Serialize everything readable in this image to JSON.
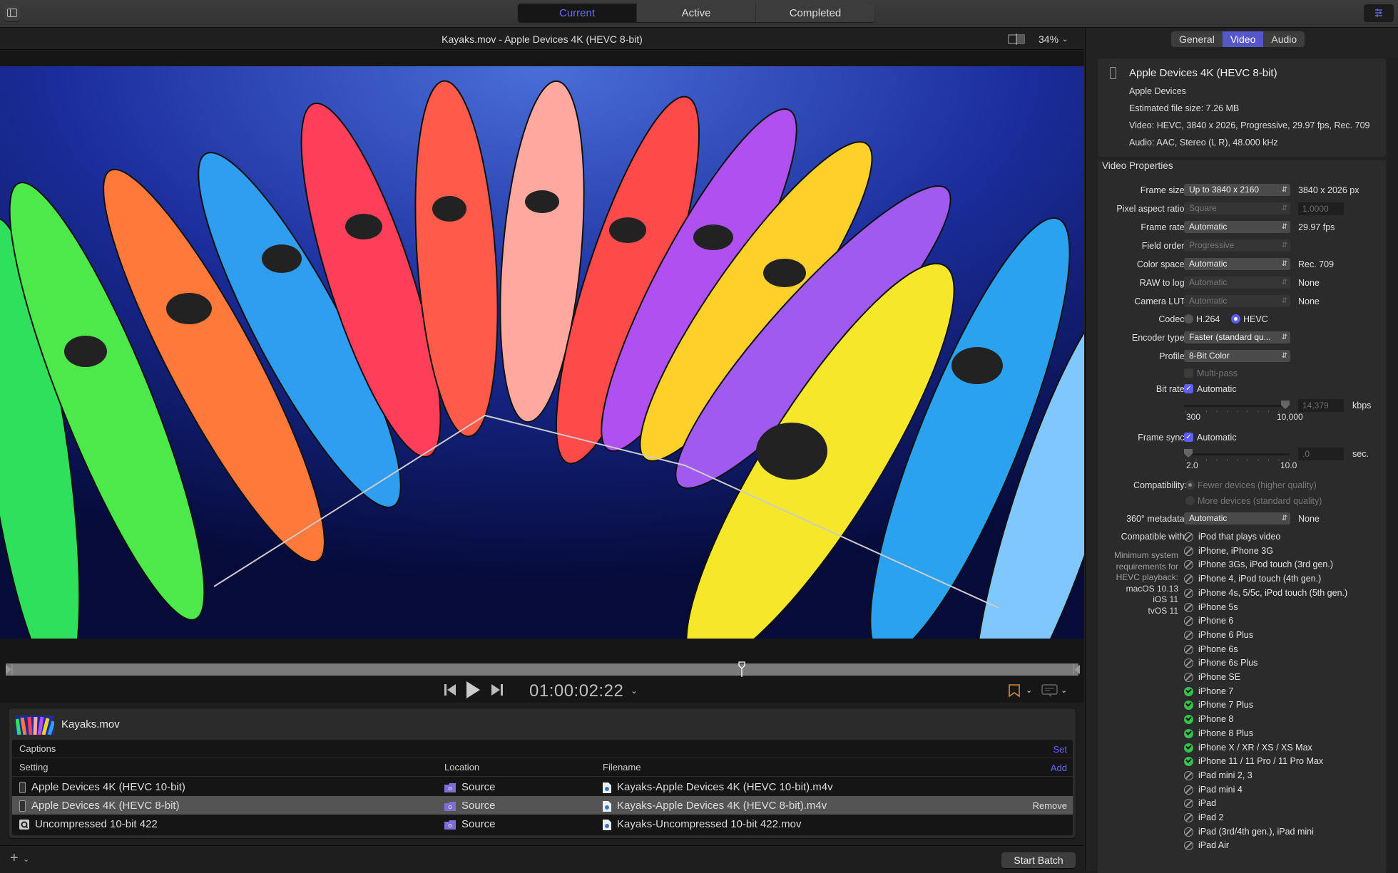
{
  "toolbar": {
    "tabs": [
      {
        "label": "Current",
        "active": true
      },
      {
        "label": "Active",
        "active": false
      },
      {
        "label": "Completed",
        "active": false
      }
    ],
    "sidebar_toggle_icon": "sidebar-icon",
    "inspector_toggle_icon": "sliders-icon"
  },
  "viewer": {
    "title": "Kayaks.mov - Apple Devices 4K (HEVC 8-bit)",
    "zoom": "34%",
    "timecode": "01:00:02:22",
    "playhead_position": 0.686
  },
  "batch": {
    "job_name": "Kayaks.mov",
    "captions_label": "Captions",
    "captions_action": "Set",
    "columns": {
      "setting": "Setting",
      "location": "Location",
      "filename": "Filename",
      "add": "Add"
    },
    "rows": [
      {
        "setting": "Apple Devices 4K (HEVC 10-bit)",
        "icon": "phone-icon",
        "location": "Source",
        "filename": "Kayaks-Apple Devices 4K (HEVC 10-bit).m4v",
        "selected": false,
        "action": ""
      },
      {
        "setting": "Apple Devices 4K (HEVC 8-bit)",
        "icon": "phone-icon",
        "location": "Source",
        "filename": "Kayaks-Apple Devices 4K (HEVC 8-bit).m4v",
        "selected": true,
        "action": "Remove"
      },
      {
        "setting": "Uncompressed 10-bit 422",
        "icon": "quicktime-icon",
        "location": "Source",
        "filename": "Kayaks-Uncompressed 10-bit 422.mov",
        "selected": false,
        "action": ""
      }
    ],
    "start_batch": "Start Batch",
    "add_symbol": "+"
  },
  "inspector": {
    "tabs": [
      {
        "label": "General",
        "active": false
      },
      {
        "label": "Video",
        "active": true
      },
      {
        "label": "Audio",
        "active": false
      }
    ],
    "summary": {
      "title": "Apple Devices 4K (HEVC 8-bit)",
      "category": "Apple Devices",
      "file_size": "Estimated file size: 7.26 MB",
      "video": "Video: HEVC, 3840 x 2026, Progressive, 29.97 fps, Rec. 709",
      "audio": "Audio: AAC, Stereo (L R), 48.000 kHz"
    },
    "section_title": "Video Properties",
    "frame_size": {
      "label": "Frame size:",
      "value": "Up to 3840 x 2160",
      "result": "3840 x 2026 px"
    },
    "pixel_aspect": {
      "label": "Pixel aspect ratio:",
      "value": "Square",
      "result": "1.0000"
    },
    "frame_rate": {
      "label": "Frame rate:",
      "value": "Automatic",
      "result": "29.97 fps"
    },
    "field_order": {
      "label": "Field order:",
      "value": "Progressive"
    },
    "color_space": {
      "label": "Color space:",
      "value": "Automatic",
      "result": "Rec. 709"
    },
    "raw_to_log": {
      "label": "RAW to log:",
      "value": "Automatic",
      "result": "None"
    },
    "camera_lut": {
      "label": "Camera LUT:",
      "value": "Automatic",
      "result": "None"
    },
    "codec": {
      "label": "Codec:",
      "options": [
        "H.264",
        "HEVC"
      ],
      "selected": "HEVC"
    },
    "encoder_type": {
      "label": "Encoder type:",
      "value": "Faster (standard qu..."
    },
    "profile": {
      "label": "Profile:",
      "value": "8-Bit Color"
    },
    "multipass": {
      "label": "Multi-pass",
      "checked": false
    },
    "bit_rate": {
      "label": "Bit rate:",
      "auto_label": "Automatic",
      "auto": true,
      "value": "14,379",
      "unit": "kbps",
      "min": "300",
      "max": "10,000",
      "slider_fraction": 1.0
    },
    "frame_sync": {
      "label": "Frame sync:",
      "auto_label": "Automatic",
      "auto": true,
      "value": ".0",
      "unit": "sec.",
      "min": "2.0",
      "max": "10.0",
      "slider_fraction": 0.0
    },
    "compatibility": {
      "label": "Compatibility:",
      "options": [
        "Fewer devices (higher quality)",
        "More devices (standard quality)"
      ],
      "selected": "Fewer devices (higher quality)"
    },
    "metadata_360": {
      "label": "360° metadata:",
      "value": "Automatic",
      "result": "None"
    },
    "compatible_with_label": "Compatible with:",
    "min_requirements": [
      "Minimum system",
      "requirements for",
      "HEVC playback:"
    ],
    "min_os": [
      "macOS 10.13",
      "iOS 11",
      "tvOS 11"
    ],
    "devices": [
      {
        "name": "iPod that plays video",
        "compatible": false
      },
      {
        "name": "iPhone, iPhone 3G",
        "compatible": false
      },
      {
        "name": "iPhone 3Gs, iPod touch (3rd gen.)",
        "compatible": false
      },
      {
        "name": "iPhone 4, iPod touch (4th gen.)",
        "compatible": false
      },
      {
        "name": "iPhone 4s, 5/5c, iPod touch (5th gen.)",
        "compatible": false
      },
      {
        "name": "iPhone 5s",
        "compatible": false
      },
      {
        "name": "iPhone 6",
        "compatible": false
      },
      {
        "name": "iPhone 6 Plus",
        "compatible": false
      },
      {
        "name": "iPhone 6s",
        "compatible": false
      },
      {
        "name": "iPhone 6s Plus",
        "compatible": false
      },
      {
        "name": "iPhone SE",
        "compatible": false
      },
      {
        "name": "iPhone 7",
        "compatible": true
      },
      {
        "name": "iPhone 7 Plus",
        "compatible": true
      },
      {
        "name": "iPhone 8",
        "compatible": true
      },
      {
        "name": "iPhone 8 Plus",
        "compatible": true
      },
      {
        "name": "iPhone X / XR / XS / XS Max",
        "compatible": true
      },
      {
        "name": "iPhone 11 / 11 Pro / 11 Pro Max",
        "compatible": true
      },
      {
        "name": "iPad mini 2, 3",
        "compatible": false
      },
      {
        "name": "iPad mini 4",
        "compatible": false
      },
      {
        "name": "iPad",
        "compatible": false
      },
      {
        "name": "iPad 2",
        "compatible": false
      },
      {
        "name": "iPad (3rd/4th gen.), iPad mini",
        "compatible": false
      },
      {
        "name": "iPad Air",
        "compatible": false
      }
    ]
  },
  "colors": {
    "accent": "#5e5ff0",
    "tab_active_text": "#6b6cf5",
    "compatible": "#33c24a",
    "marker": "#e08a2a"
  }
}
